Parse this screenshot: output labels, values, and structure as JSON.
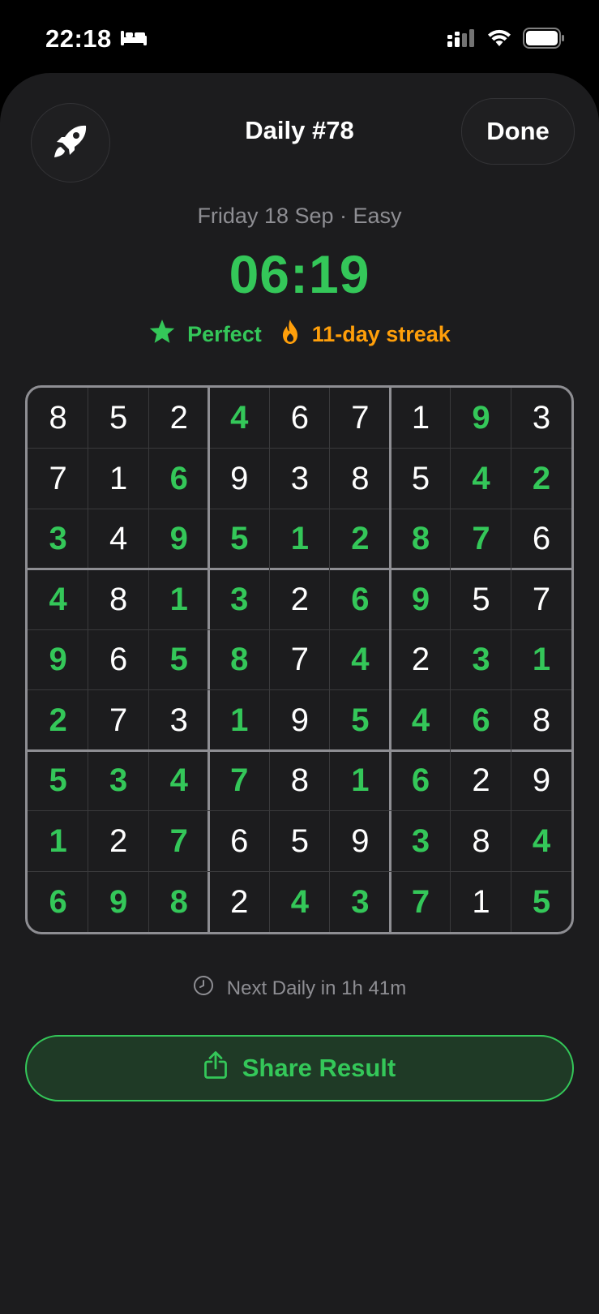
{
  "status_bar": {
    "time": "22:18",
    "icons": [
      "bed-icon",
      "signal-icon",
      "wifi-icon",
      "battery-icon"
    ]
  },
  "header": {
    "title": "Daily #78",
    "done_label": "Done",
    "left_icon": "rocket-icon"
  },
  "puzzle": {
    "subtitle": "Friday 18 Sep · Easy",
    "timer": "06:19",
    "badges": [
      {
        "icon": "star-icon",
        "label": "Perfect",
        "color": "#34c759"
      },
      {
        "icon": "flame-icon",
        "label": "11-day streak",
        "color": "#ff9f0a"
      }
    ]
  },
  "board": {
    "values": [
      [
        8,
        5,
        2,
        4,
        6,
        7,
        1,
        9,
        3
      ],
      [
        7,
        1,
        6,
        9,
        3,
        8,
        5,
        4,
        2
      ],
      [
        3,
        4,
        9,
        5,
        1,
        2,
        8,
        7,
        6
      ],
      [
        4,
        8,
        1,
        3,
        2,
        6,
        9,
        5,
        7
      ],
      [
        9,
        6,
        5,
        8,
        7,
        4,
        2,
        3,
        1
      ],
      [
        2,
        7,
        3,
        1,
        9,
        5,
        4,
        6,
        8
      ],
      [
        5,
        3,
        4,
        7,
        8,
        1,
        6,
        2,
        9
      ],
      [
        1,
        2,
        7,
        6,
        5,
        9,
        3,
        8,
        4
      ],
      [
        6,
        9,
        8,
        2,
        4,
        3,
        7,
        1,
        5
      ]
    ],
    "filled_mask": [
      [
        0,
        0,
        0,
        1,
        0,
        0,
        0,
        1,
        0
      ],
      [
        0,
        0,
        1,
        0,
        0,
        0,
        0,
        1,
        1
      ],
      [
        1,
        0,
        1,
        1,
        1,
        1,
        1,
        1,
        0
      ],
      [
        1,
        0,
        1,
        1,
        0,
        1,
        1,
        0,
        0
      ],
      [
        1,
        0,
        1,
        1,
        0,
        1,
        0,
        1,
        1
      ],
      [
        1,
        0,
        0,
        1,
        0,
        1,
        1,
        1,
        0
      ],
      [
        1,
        1,
        1,
        1,
        0,
        1,
        1,
        0,
        0
      ],
      [
        1,
        0,
        1,
        0,
        0,
        0,
        1,
        0,
        1
      ],
      [
        1,
        1,
        1,
        0,
        1,
        1,
        1,
        0,
        1
      ]
    ],
    "given_color": "#ffffff",
    "filled_color": "#34c759"
  },
  "footer": {
    "next_daily": "Next Daily in 1h 41m",
    "share_label": "Share Result"
  },
  "colors": {
    "accent": "#34c759",
    "streak": "#ff9f0a",
    "sheet_bg": "#1c1c1e",
    "muted": "#8e8e93"
  }
}
